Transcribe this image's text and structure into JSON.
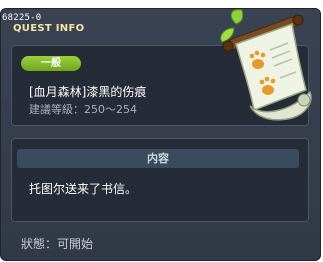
{
  "header": {
    "quest_id": "68225-0",
    "title": "QUEST INFO"
  },
  "quest": {
    "category_badge": "一般",
    "name": "[血月森林]漆黑的伤痕",
    "level_requirement": "建議等級：250～254",
    "icon": "scroll-icon"
  },
  "content": {
    "header": "内容",
    "text": "托图尔送来了书信。"
  },
  "status": {
    "text": "狀態：可開始"
  },
  "colors": {
    "badge": "#7fb52c",
    "title": "#f2e6a2",
    "window": "#363e4c"
  }
}
